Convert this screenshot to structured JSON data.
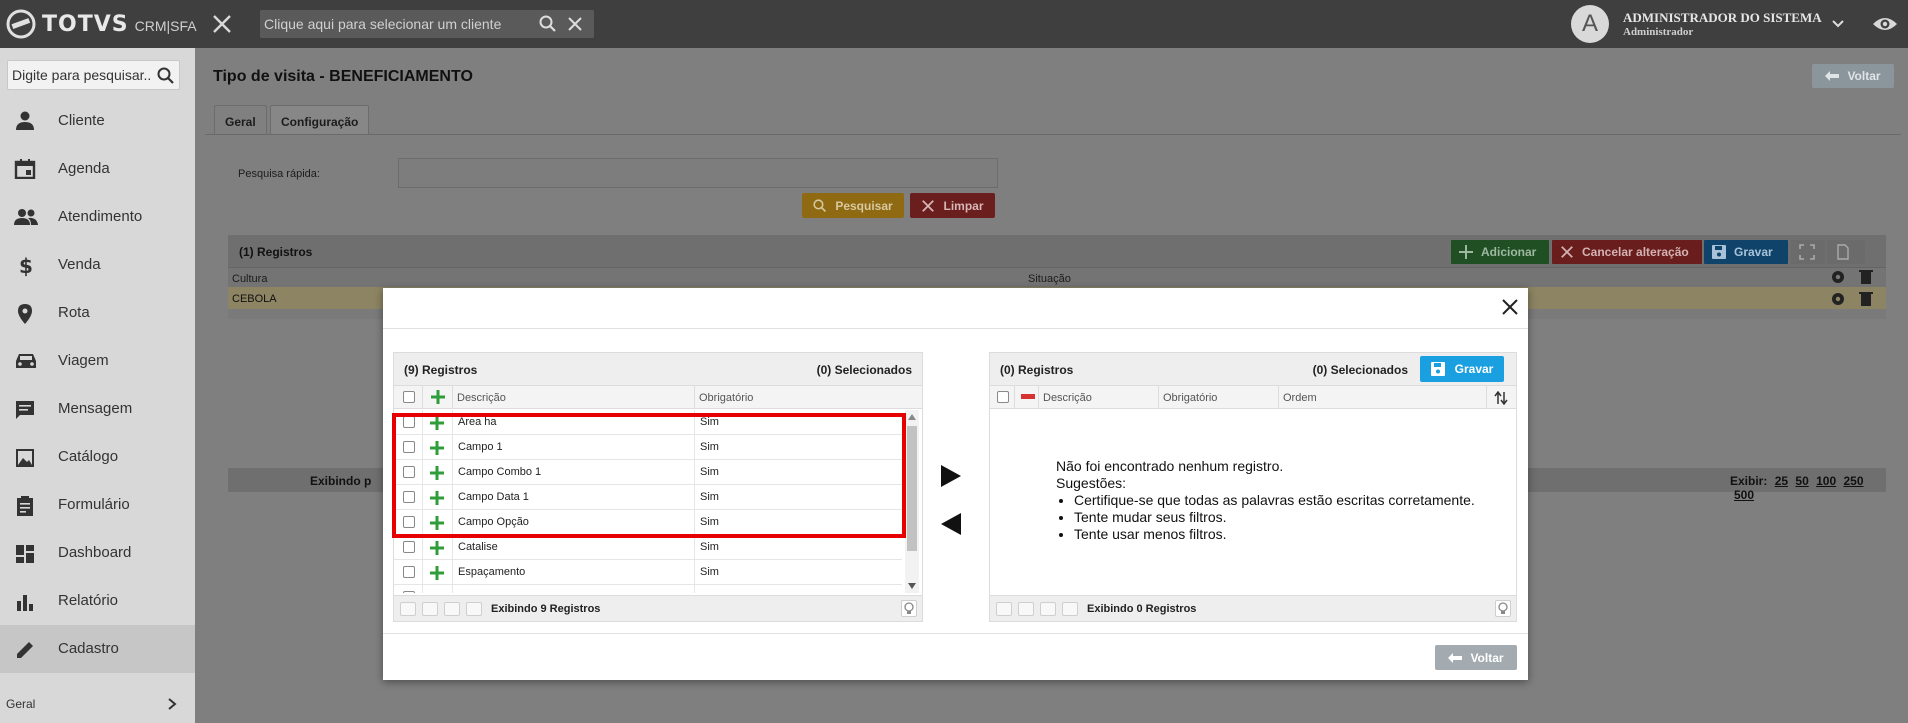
{
  "topbar": {
    "brand": "TOTVS",
    "brand_sub": "CRM|SFA",
    "client_placeholder": "Clique aqui para selecionar um cliente",
    "avatar_letter": "A",
    "user_name": "ADMINISTRADOR DO SISTEMA",
    "user_role": "Administrador"
  },
  "sidebar": {
    "search_placeholder": "Digite para pesquisar...",
    "items": [
      {
        "label": "Cliente",
        "icon": "person-icon"
      },
      {
        "label": "Agenda",
        "icon": "calendar-icon"
      },
      {
        "label": "Atendimento",
        "icon": "people-icon"
      },
      {
        "label": "Venda",
        "icon": "dollar-icon"
      },
      {
        "label": "Rota",
        "icon": "map-pin-icon"
      },
      {
        "label": "Viagem",
        "icon": "car-icon"
      },
      {
        "label": "Mensagem",
        "icon": "message-icon"
      },
      {
        "label": "Catálogo",
        "icon": "image-icon"
      },
      {
        "label": "Formulário",
        "icon": "clipboard-icon"
      },
      {
        "label": "Dashboard",
        "icon": "dashboard-icon"
      },
      {
        "label": "Relatório",
        "icon": "bar-chart-icon"
      },
      {
        "label": "Cadastro",
        "icon": "pencil-icon"
      }
    ],
    "footer_label": "Geral"
  },
  "page": {
    "title": "Tipo de visita - BENEFICIAMENTO",
    "back_label": "Voltar",
    "tabs": [
      "Geral",
      "Configuração"
    ],
    "quick_search_label": "Pesquisa rápida:",
    "search_button": "Pesquisar",
    "clear_button": "Limpar"
  },
  "grid": {
    "count": "(1) Registros",
    "add_button": "Adicionar",
    "cancel_button": "Cancelar alteração",
    "save_button": "Gravar",
    "columns": [
      "Cultura",
      "Situação"
    ],
    "rows": [
      {
        "cultura": "CEBOLA"
      }
    ],
    "pager_text": "Exibindo p",
    "show_label": "Exibir:",
    "page_sizes": [
      "25",
      "50",
      "100",
      "250",
      "500"
    ]
  },
  "modal": {
    "left": {
      "count": "(9) Registros",
      "selected": "(0) Selecionados",
      "columns": [
        "Descrição",
        "Obrigatório"
      ],
      "rows": [
        {
          "desc": "Area ha",
          "obr": "Sim"
        },
        {
          "desc": "Campo 1",
          "obr": "Sim"
        },
        {
          "desc": "Campo Combo 1",
          "obr": "Sim"
        },
        {
          "desc": "Campo Data 1",
          "obr": "Sim"
        },
        {
          "desc": "Campo Opção",
          "obr": "Sim"
        },
        {
          "desc": "Catalise",
          "obr": "Sim"
        },
        {
          "desc": "Espaçamento",
          "obr": "Sim"
        }
      ],
      "footer": "Exibindo 9 Registros"
    },
    "right": {
      "count": "(0) Registros",
      "selected": "(0) Selecionados",
      "save_button": "Gravar",
      "columns": [
        "Descrição",
        "Obrigatório",
        "Ordem"
      ],
      "empty_title": "Não foi encontrado nenhum registro.",
      "empty_suggestions": "Sugestões:",
      "empty_tips": [
        "Certifique-se que todas as palavras estão escritas corretamente.",
        "Tente mudar seus filtros.",
        "Tente usar menos filtros."
      ],
      "footer": "Exibindo 0 Registros"
    },
    "back_button": "Voltar"
  },
  "colors": {
    "topbar": "#3f3f3f",
    "accent_blue": "#1aa0e0",
    "add_green": "#2e9d3a",
    "highlight_red": "#e60000"
  }
}
